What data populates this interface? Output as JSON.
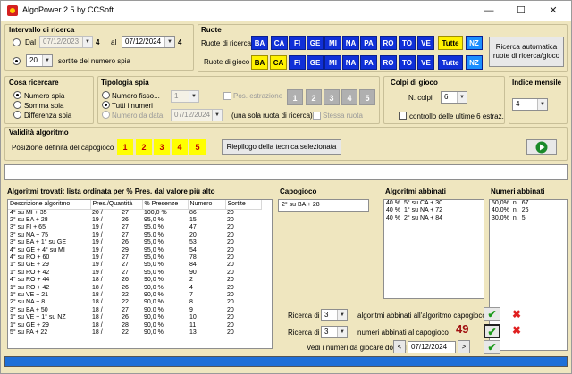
{
  "window": {
    "title": "AlgoPower 2.5 by CCSoft",
    "minimize": "—",
    "maximize": "☐",
    "close": "✕"
  },
  "intervallo": {
    "title": "Intervallo di ricerca",
    "dal_label": "Dal",
    "dal_value": "07/12/2023",
    "dal_num": "4",
    "al_label": "al",
    "al_value": "07/12/2024",
    "al_num": "4",
    "sortite_value": "20",
    "sortite_label": "sortite del numero spia"
  },
  "ruote": {
    "title": "Ruote",
    "ricerca_label": "Ruote di ricerca",
    "gioco_label": "Ruote di gioco",
    "items": [
      "BA",
      "CA",
      "FI",
      "GE",
      "MI",
      "NA",
      "PA",
      "RO",
      "TO",
      "VE",
      "Tutte",
      "NZ"
    ],
    "auto_button": "Ricerca automatica ruote di ricerca/gioco"
  },
  "cosa": {
    "title": "Cosa ricercare",
    "options": [
      "Numero spia",
      "Somma spia",
      "Differenza spia"
    ]
  },
  "tipologia": {
    "title": "Tipologia spia",
    "options": [
      "Numero fisso...",
      "Tutti i numeri",
      "Numero da data"
    ],
    "fisso_value": "1",
    "date_value": "07/12/2024",
    "pos_label": "Pos. estrazione",
    "pos_boxes": [
      "1",
      "2",
      "3",
      "4",
      "5"
    ],
    "una_sola": "(una sola ruota di ricerca)",
    "stessa_label": "Stessa ruota"
  },
  "colpi": {
    "title": "Colpi di gioco",
    "ncolpi_label": "N. colpi",
    "ncolpi_value": "6",
    "controllo_label": "controllo delle ultime 6 estraz."
  },
  "indice": {
    "title": "Indice mensile",
    "value": "4"
  },
  "validita": {
    "title": "Validità algoritmo",
    "posizione_label": "Posizione definita del capogioco",
    "boxes": [
      "1",
      "2",
      "3",
      "4",
      "5"
    ],
    "riepilogo_button": "Riepilogo della tecnica selezionata",
    "play_icon": "play-icon"
  },
  "algoritmi": {
    "title": "Algoritmi trovati: lista ordinata per % Pres. dal valore più alto",
    "columns": [
      "Descrizione algoritmo",
      "Pres./Quantità",
      "% Presenze",
      "Numero",
      "Sortite"
    ],
    "rows": [
      [
        "4° su MI + 35",
        "20 /",
        "27",
        "100,0 %",
        "86",
        "20"
      ],
      [
        "2° su BA + 28",
        "19 /",
        "26",
        "95,0 %",
        "15",
        "20"
      ],
      [
        "3° su FI + 65",
        "19 /",
        "27",
        "95,0 %",
        "47",
        "20"
      ],
      [
        "3° su NA + 75",
        "19 /",
        "27",
        "95,0 %",
        "20",
        "20"
      ],
      [
        "3° su BA + 1° su GE",
        "19 /",
        "26",
        "95,0 %",
        "53",
        "20"
      ],
      [
        "4° su GE + 4° su MI",
        "19 /",
        "29",
        "95,0 %",
        "54",
        "20"
      ],
      [
        "4° su RO + 60",
        "19 /",
        "27",
        "95,0 %",
        "78",
        "20"
      ],
      [
        "1° su GE + 29",
        "19 /",
        "27",
        "95,0 %",
        "84",
        "20"
      ],
      [
        "1° su RO + 42",
        "19 /",
        "27",
        "95,0 %",
        "90",
        "20"
      ],
      [
        "4° su RO + 44",
        "18 /",
        "26",
        "90,0 %",
        "2",
        "20"
      ],
      [
        "1° su RO + 42",
        "18 /",
        "26",
        "90,0 %",
        "4",
        "20"
      ],
      [
        "1° su VE + 21",
        "18 /",
        "22",
        "90,0 %",
        "7",
        "20"
      ],
      [
        "2° su NA + 8",
        "18 /",
        "22",
        "90,0 %",
        "8",
        "20"
      ],
      [
        "3° su BA + 50",
        "18 /",
        "27",
        "90,0 %",
        "9",
        "20"
      ],
      [
        "1° su VE + 1° su NZ",
        "18 /",
        "26",
        "90,0 %",
        "10",
        "20"
      ],
      [
        "1° su GE + 29",
        "18 /",
        "28",
        "90,0 %",
        "11",
        "20"
      ],
      [
        "5° su PA + 22",
        "18 /",
        "22",
        "90,0 %",
        "13",
        "20"
      ]
    ]
  },
  "capogioco": {
    "title": "Capogioco",
    "value": "2° su BA + 28"
  },
  "abbinati": {
    "title": "Algoritmi abbinati",
    "rows": [
      [
        "40 %",
        "5° su CA + 30"
      ],
      [
        "40 %",
        "1° su NA + 72"
      ],
      [
        "40 %",
        "2° su NA + 84"
      ]
    ]
  },
  "numeri": {
    "title": "Numeri abbinati",
    "rows": [
      [
        "50,0%",
        "n.",
        "67"
      ],
      [
        "40,0%",
        "n.",
        "26"
      ],
      [
        "30,0%",
        "n.",
        "5"
      ]
    ]
  },
  "ricerca1": {
    "label": "Ricerca di",
    "value": "3",
    "desc": "algoritmi abbinati all'algoritmo capogioco"
  },
  "ricerca2": {
    "label": "Ricerca di",
    "value": "3",
    "desc": "numeri abbinati al capogioco",
    "result": "49"
  },
  "vedi": {
    "label": "Vedi i numeri da giocare dopo il",
    "date": "07/12/2024",
    "prev": "<",
    "next": ">"
  },
  "colors": {
    "panel": "#efe6bf",
    "ruota_blue": "#1030d8",
    "ruota_yellow": "#fff200",
    "status_blue": "#1e6fd8"
  }
}
